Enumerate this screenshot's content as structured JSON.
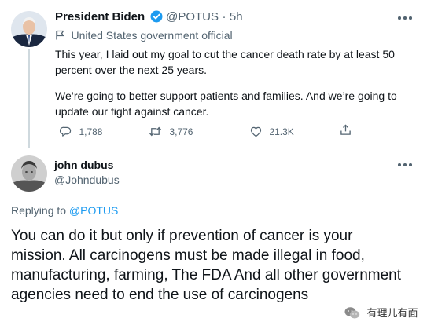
{
  "original_tweet": {
    "display_name": "President Biden",
    "verified_icon": "verified-badge-icon",
    "handle": "@POTUS",
    "separator": "·",
    "time": "5h",
    "label_icon": "flag-icon",
    "label": "United States government official",
    "text_p1": "This year, I laid out my goal to cut the cancer death rate by at least 50 percent over the next 25 years.",
    "text_p2": "We’re going to better support patients and families. And we’re going to update our fight against cancer.",
    "stats": {
      "replies": "1,788",
      "retweets": "3,776",
      "likes": "21.3K"
    }
  },
  "reply_tweet": {
    "display_name": "john dubus",
    "handle": "@Johndubus",
    "replying_prefix": "Replying to ",
    "replying_to": "@POTUS",
    "text": "You can do it but only if prevention of cancer is your mission. All carcinogens must be made illegal in food, manufacturing, farming, The FDA And all other government agencies need to end the use of carcinogens"
  },
  "watermark": {
    "icon": "wechat-icon",
    "text": "有理儿有面"
  },
  "colors": {
    "accent": "#1d9bf0",
    "secondary_text": "#536471",
    "thread_line": "#cfd9de"
  }
}
